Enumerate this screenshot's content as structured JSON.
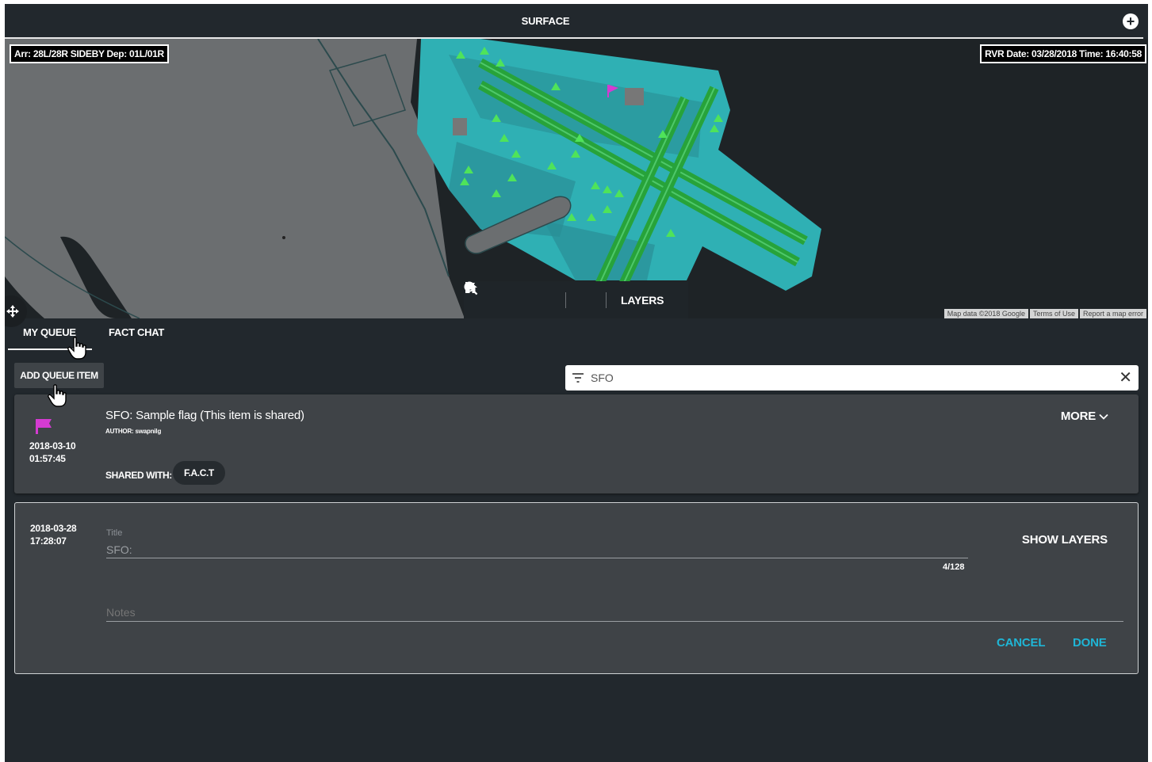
{
  "header": {
    "title": "SURFACE",
    "add_icon": "plus-circle-icon"
  },
  "map": {
    "runway_config": "Arr: 28L/28R SIDEBY Dep: 01L/01R",
    "rvr_info": "RVR Date: 03/28/2018 Time: 16:40:58",
    "toolbar": {
      "home_icon": "home-icon",
      "zoom_in_icon": "zoom-in-icon",
      "zoom_out_icon": "zoom-out-icon",
      "flag_icon": "flag-icon",
      "layers_label": "LAYERS"
    },
    "attribution": {
      "map_data": "Map data ©2018 Google",
      "terms": "Terms of Use",
      "report": "Report a map error"
    },
    "colors": {
      "airport": "#2fb0b4",
      "runway": "#27a33a",
      "water": "#1e2326",
      "land": "#6b6e70",
      "flag": "#d43bd1"
    }
  },
  "tabs": [
    {
      "label": "MY QUEUE",
      "active": true
    },
    {
      "label": "FACT CHAT",
      "active": false
    }
  ],
  "queue": {
    "add_item_label": "ADD QUEUE ITEM",
    "filter": {
      "value": "SFO",
      "icon": "filter-icon",
      "clear_icon": "close-icon"
    },
    "items": [
      {
        "date": "2018-03-10",
        "time": "01:57:45",
        "flag_color": "#d43bd1",
        "title": "SFO: Sample flag (This item is shared)",
        "author_label": "AUTHOR:",
        "author": "swapnilg",
        "more_label": "MORE",
        "shared_with_label": "SHARED WITH:",
        "shared_with": "F.A.C.T"
      }
    ],
    "editor": {
      "date": "2018-03-28",
      "time": "17:28:07",
      "title_label": "Title",
      "title_value": "SFO:",
      "char_count": "4/128",
      "notes_placeholder": "Notes",
      "show_layers_label": "SHOW LAYERS",
      "cancel_label": "CANCEL",
      "done_label": "DONE"
    }
  },
  "accent_color": "#1fb6d6"
}
